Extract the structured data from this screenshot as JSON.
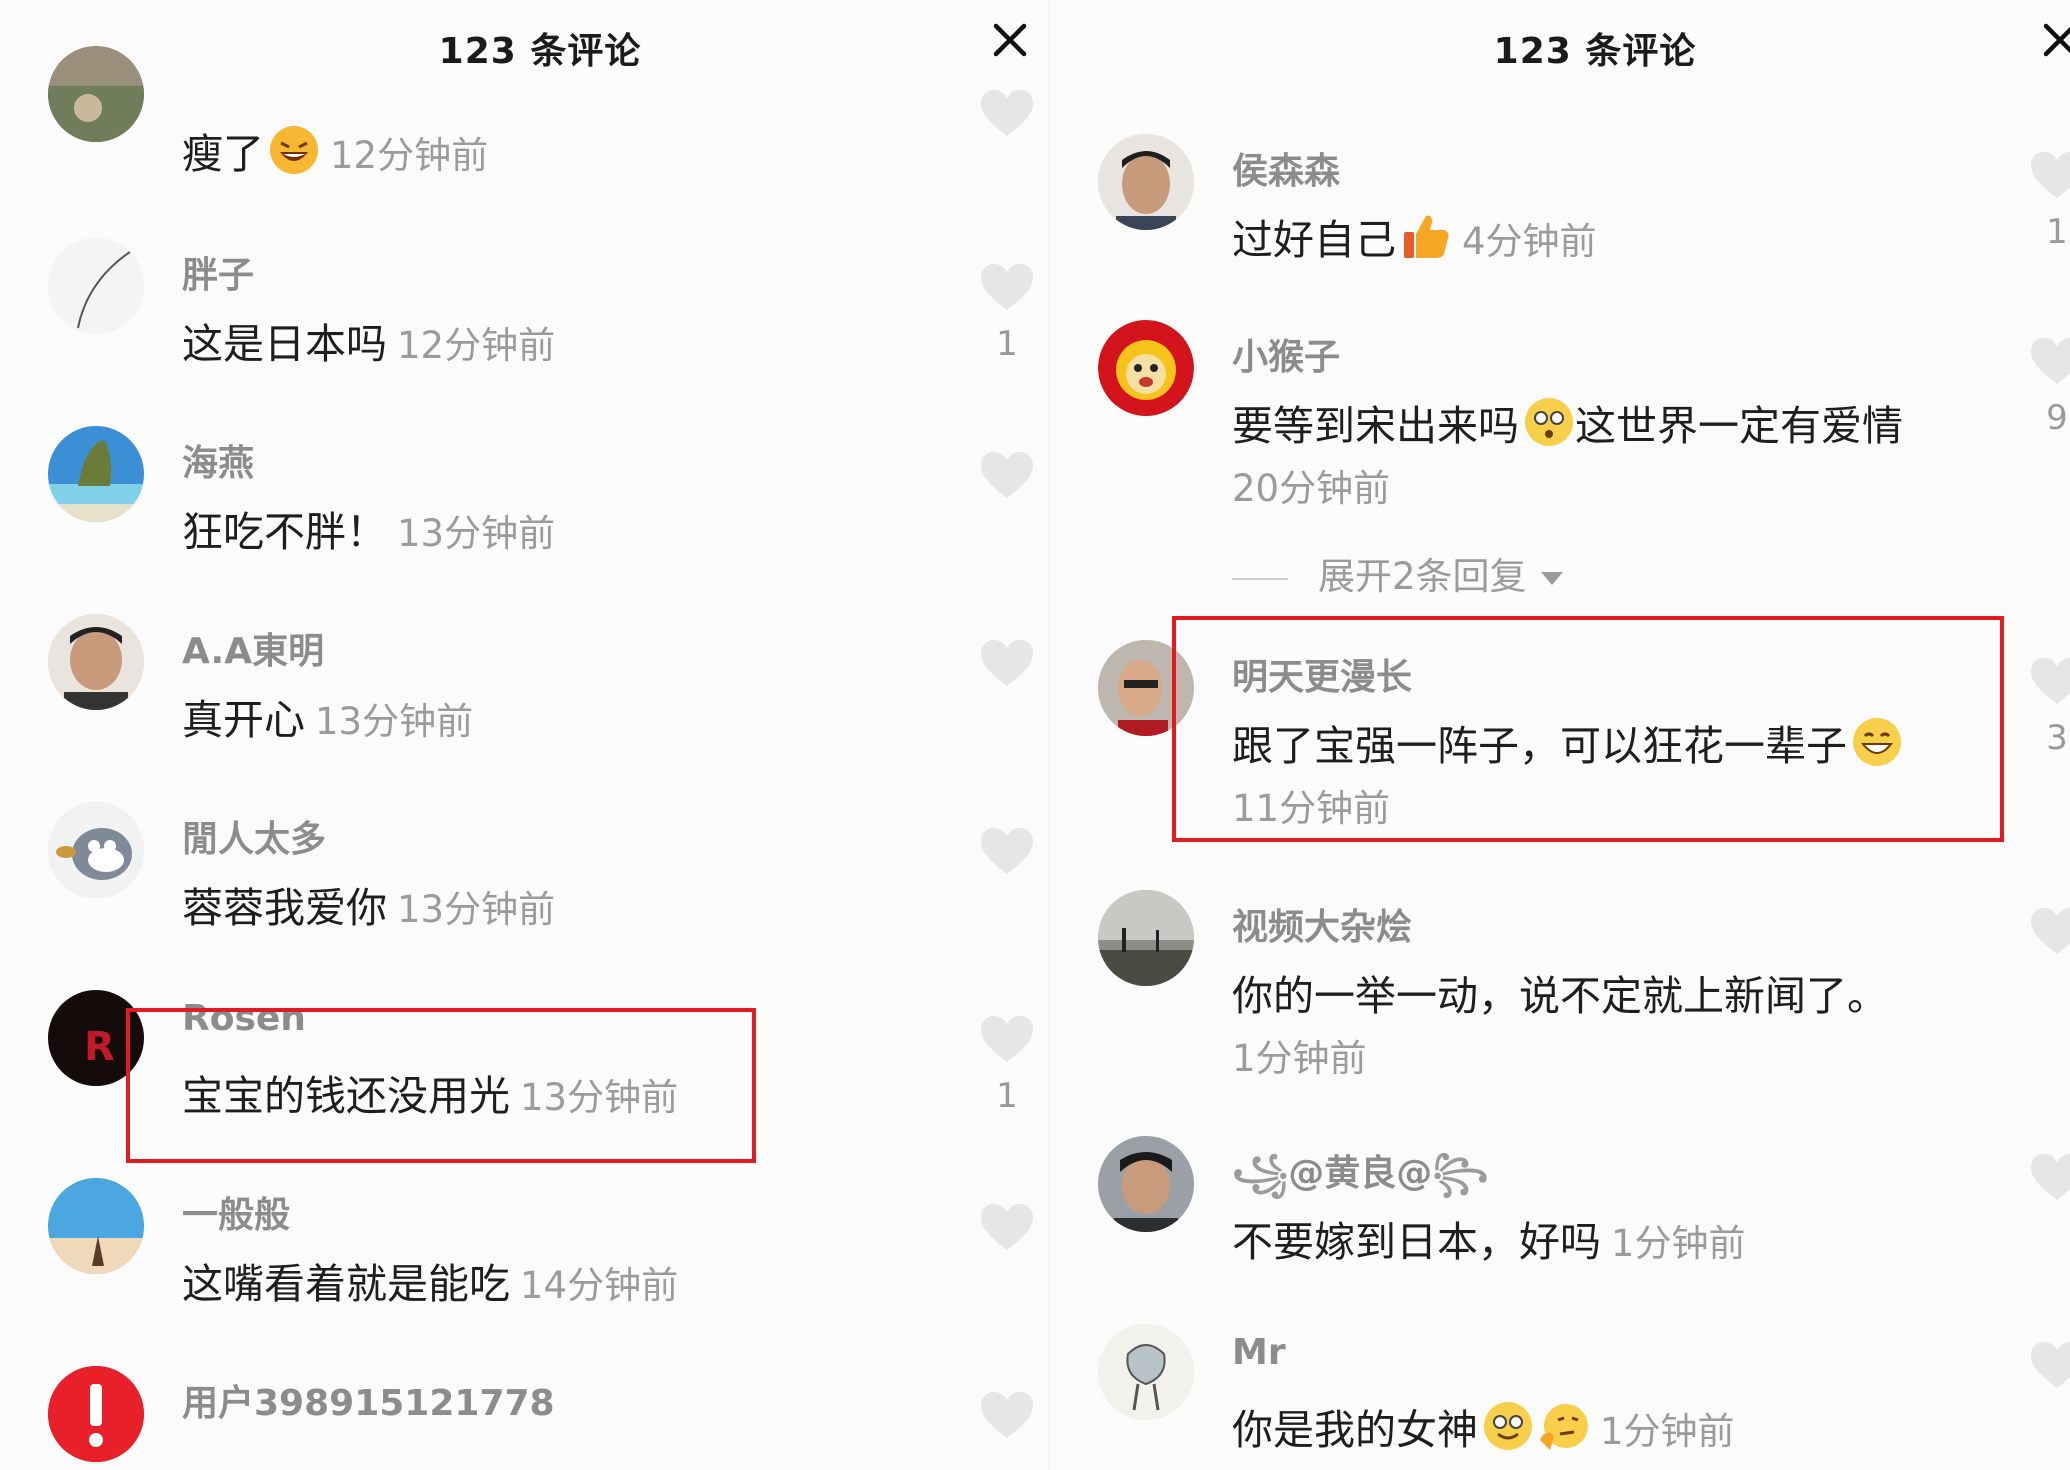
{
  "left_panel": {
    "title": "123 条评论",
    "comments": [
      {
        "user": "",
        "text": "瘦了",
        "time": "12分钟前",
        "likes": ""
      },
      {
        "user": "胖子",
        "text": "这是日本吗",
        "time": "12分钟前",
        "likes": "1"
      },
      {
        "user": "海燕",
        "text": "狂吃不胖！",
        "time": "13分钟前",
        "likes": ""
      },
      {
        "user": "A.A東明",
        "text": "真开心",
        "time": "13分钟前",
        "likes": ""
      },
      {
        "user": "閒人太多",
        "text": "蓉蓉我爱你",
        "time": "13分钟前",
        "likes": ""
      },
      {
        "user": "Rosen",
        "text": "宝宝的钱还没用光",
        "time": "13分钟前",
        "likes": "1"
      },
      {
        "user": "一般般",
        "text": "这嘴看着就是能吃",
        "time": "14分钟前",
        "likes": ""
      },
      {
        "user": "用户398915121778",
        "text": "",
        "time": "",
        "likes": ""
      }
    ]
  },
  "right_panel": {
    "title": "123 条评论",
    "comments": [
      {
        "user": "侯森森",
        "text": "过好自己",
        "time": "4分钟前",
        "likes": "1"
      },
      {
        "user": "小猴子",
        "text": "要等到宋出来吗",
        "text2": "这世界一定有爱情",
        "time": "20分钟前",
        "likes": "9",
        "replies": "展开2条回复"
      },
      {
        "user": "明天更漫长",
        "text": "跟了宝强一阵子，可以狂花一辈子",
        "time": "11分钟前",
        "likes": "3"
      },
      {
        "user": "视频大杂烩",
        "text": "你的一举一动，说不定就上新闻了。",
        "time": "1分钟前",
        "likes": ""
      },
      {
        "user": "@黄良@",
        "text": "不要嫁到日本，好吗",
        "time": "1分钟前",
        "likes": ""
      },
      {
        "user": "Mr",
        "text": "你是我的女神",
        "time": "1分钟前",
        "likes": ""
      }
    ]
  },
  "icons": [
    "close-icon",
    "heart-icon",
    "laugh-emoji",
    "thumbs-up-emoji",
    "dizzy-emoji",
    "grin-emoji",
    "smile-emoji",
    "thinking-emoji",
    "caret-down-icon"
  ],
  "colors": {
    "highlight": "#e21b23",
    "username": "#8c8c8c",
    "time": "#9b9b9b",
    "heart": "#e6e6e6"
  }
}
